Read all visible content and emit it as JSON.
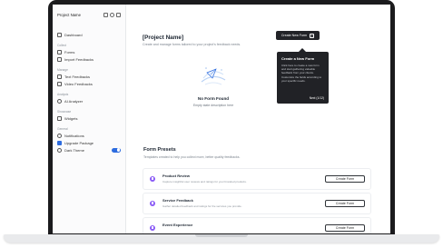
{
  "sidebar": {
    "project_name": "Project Name",
    "dashboard": "Dashboard",
    "sections": [
      {
        "label": "Collect",
        "items": [
          "Forms",
          "Import Feedbacks"
        ]
      },
      {
        "label": "Manage",
        "items": [
          "Text Feedbacks",
          "Video Feedbacks"
        ]
      },
      {
        "label": "Analysis",
        "items": [
          "AI Analyzer"
        ]
      },
      {
        "label": "Showcase",
        "items": [
          "Widgets"
        ]
      },
      {
        "label": "General",
        "items": [
          "Notifications",
          "Upgrade Package",
          "Dark Theme"
        ]
      }
    ],
    "dark_theme_on": true
  },
  "header": {
    "title": "[Project Name]",
    "subtitle": "Create and manage forms tailored to your project's feedback needs.",
    "create_button": "Create New Form"
  },
  "tooltip": {
    "title": "Create a New Form",
    "body": "Click here to create a new form and start gathering valuable feedback from your clients. Customize the fields according to your specific needs.",
    "next": "Next (1/12)"
  },
  "empty_state": {
    "title": "No Form Found",
    "description": "Empty state description here"
  },
  "presets": {
    "title": "Form Presets",
    "subtitle": "Templates created to help you collect more, better quality feedbacks.",
    "items": [
      {
        "title": "Product Review",
        "description": "Capture insightful user reviews and ratings for your branded products.",
        "button": "Create Form"
      },
      {
        "title": "Service Feedback",
        "description": "Gather detailed feedback and ratings for the services you provide.",
        "button": "Create Form"
      },
      {
        "title": "Event Experience",
        "description": "",
        "button": "Create Form"
      }
    ]
  },
  "colors": {
    "accent": "#2d6cdf",
    "dark": "#222327",
    "preset_icon": "#8b5cf6"
  }
}
